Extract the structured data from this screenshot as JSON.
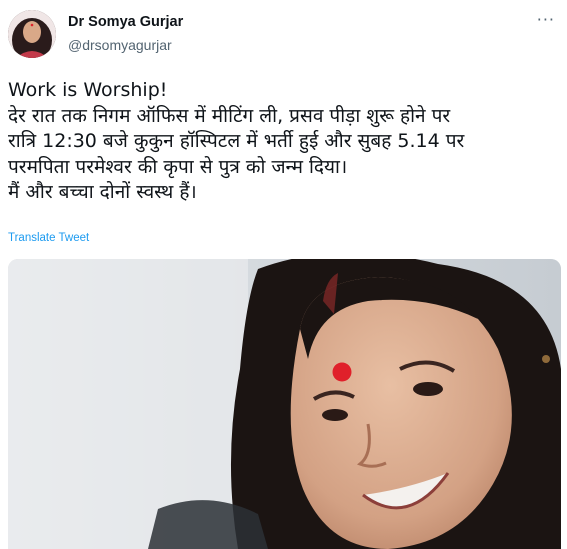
{
  "author": {
    "display_name": "Dr Somya Gurjar",
    "handle": "@drsomyagurjar"
  },
  "menu": {
    "more_icon": "more-horizontal-icon"
  },
  "tweet": {
    "lines": [
      "Work is Worship!",
      "देर रात तक निगम ऑफिस में मीटिंग ली, प्रसव पीड़ा शुरू होने पर",
      "रात्रि 12:30 बजे कुकुन हॉस्पिटल में भर्ती हुई और सुबह 5.14 पर",
      "परमपिता परमेश्वर की कृपा से पुत्र को जन्म दिया।",
      "मैं और बच्चा दोनों स्वस्थ हैं।"
    ],
    "translate_label": "Translate Tweet"
  },
  "colors": {
    "link": "#1d9bf0",
    "secondary_text": "#536471",
    "bindi": "#e0202a"
  }
}
